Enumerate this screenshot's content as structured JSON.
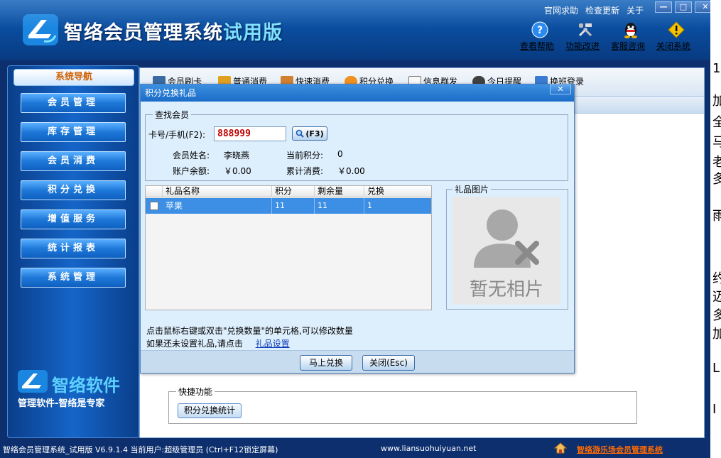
{
  "app": {
    "title_main": "智络会员管理系统",
    "title_trial": "试用版"
  },
  "toplinks": [
    "官网求助",
    "检查更新",
    "关于"
  ],
  "winbtns": [
    "—",
    "□",
    "✕"
  ],
  "tools": [
    {
      "label": "查看帮助",
      "icon": "help-icon"
    },
    {
      "label": "功能改进",
      "icon": "tools-icon"
    },
    {
      "label": "客服咨询",
      "icon": "qq-icon"
    },
    {
      "label": "关闭系统",
      "icon": "warning-icon"
    }
  ],
  "sidebar": {
    "title": "系统导航",
    "items": [
      "会员管理",
      "库存管理",
      "会员消费",
      "积分兑换",
      "增值服务",
      "统计报表",
      "系统管理"
    ],
    "brand": "智络软件",
    "slogan": "管理软件-智络是专家"
  },
  "main_toolbar": [
    "会员刷卡",
    "普通消费",
    "快速消费",
    "积分兑换",
    "信息群发",
    "今日提醒",
    "换班登录"
  ],
  "quick": {
    "legend": "快捷功能",
    "button": "积分兑换统计"
  },
  "statusbar": {
    "left": "智络会员管理系统_试用版 V6.9.1.4 当前用户:超级管理员 (Ctrl+F12锁定屏幕)",
    "url": "www.liansuohuiyuan.net",
    "right": "智络游乐场会员管理系统"
  },
  "dialog": {
    "title": "积分兑换礼品",
    "close": "✕",
    "find_legend": "查找会员",
    "card_label": "卡号/手机(F2):",
    "card_value": "888999",
    "search_label": "(F3)",
    "name_label": "会员姓名:",
    "name_value": "李晓燕",
    "points_label": "当前积分:",
    "points_value": "0",
    "balance_label": "账户余额:",
    "balance_value": "￥0.00",
    "total_label": "累计消费:",
    "total_value": "￥0.00",
    "grid_headers": [
      "礼品名称",
      "积分",
      "剩余量",
      "兑换"
    ],
    "grid_rows": [
      {
        "name": "苹果",
        "points": "11",
        "remaining": "11",
        "exchange": "1"
      }
    ],
    "pic_legend": "礼品图片",
    "nopic": "暂无相片",
    "hint1": "点击鼠标右键或双击\"兑换数量\"的单元格,可以修改数量",
    "hint2_prefix": "如果还未设置礼品,请点击",
    "hint2_link": "礼品设置",
    "btn_exchange": "马上兑换",
    "btn_close": "关闭(Esc)"
  },
  "right_strip": [
    "1",
    "加",
    "全",
    "马",
    "老",
    "多",
    "雨",
    "约",
    "迈",
    "多",
    "加",
    "L",
    "I"
  ],
  "colors": {
    "frame": "#0d2f6e",
    "header": "#0a4a9a",
    "dialog_title": "#1a6cc8",
    "selected_row": "#3c8fe4",
    "card_text": "#c00000",
    "status_link": "#ff6a00"
  }
}
